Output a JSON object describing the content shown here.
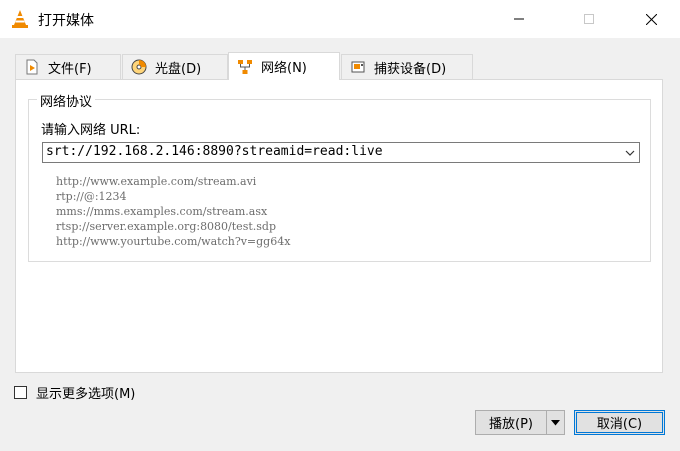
{
  "window": {
    "title": "打开媒体",
    "controls": {
      "minimize": "minimize-icon",
      "maximize": "maximize-icon",
      "close": "close-icon"
    }
  },
  "tabs": [
    {
      "label": "文件(F)",
      "icon": "file-play-icon",
      "active": false
    },
    {
      "label": "光盘(D)",
      "icon": "disc-icon",
      "active": false
    },
    {
      "label": "网络(N)",
      "icon": "network-icon",
      "active": true
    },
    {
      "label": "捕获设备(D)",
      "icon": "capture-device-icon",
      "active": false
    }
  ],
  "network": {
    "group_title": "网络协议",
    "url_label": "请输入网络 URL:",
    "url_value": "srt://192.168.2.146:8890?streamid=read:live",
    "examples": [
      "http://www.example.com/stream.avi",
      "rtp://@:1234",
      "mms://mms.examples.com/stream.asx",
      "rtsp://server.example.org:8080/test.sdp",
      "http://www.yourtube.com/watch?v=gg64x"
    ]
  },
  "more_options": {
    "label": "显示更多选项(M)",
    "checked": false
  },
  "buttons": {
    "play": "播放(P)",
    "cancel": "取消(C)"
  },
  "colors": {
    "accent": "#0078d7",
    "vlc_orange": "#f08a00",
    "example_text": "#6d6d6d"
  }
}
